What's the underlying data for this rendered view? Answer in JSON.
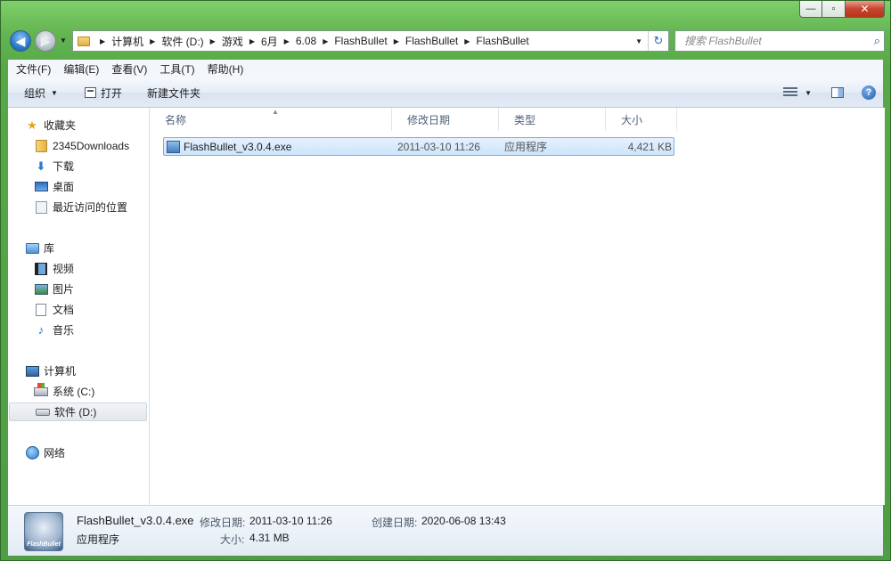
{
  "window": {
    "caption": {
      "minimize": "—",
      "maximize": "▫",
      "close": "✕"
    }
  },
  "nav": {
    "back": "◀",
    "forward": "▶",
    "drop": "▼"
  },
  "address": {
    "crumbs": [
      "计算机",
      "软件 (D:)",
      "游戏",
      "6月",
      "6.08",
      "FlashBullet",
      "FlashBullet",
      "FlashBullet"
    ],
    "refresh": "↻"
  },
  "search": {
    "placeholder": "搜索 FlashBullet"
  },
  "menu": [
    "文件(F)",
    "编辑(E)",
    "查看(V)",
    "工具(T)",
    "帮助(H)"
  ],
  "toolbar": {
    "organize": "组织",
    "open": "打开",
    "new_folder": "新建文件夹",
    "help": "?"
  },
  "sidebar": {
    "favorites": {
      "label": "收藏夹",
      "items": [
        "2345Downloads",
        "下载",
        "桌面",
        "最近访问的位置"
      ]
    },
    "libraries": {
      "label": "库",
      "items": [
        "视频",
        "图片",
        "文档",
        "音乐"
      ]
    },
    "computer": {
      "label": "计算机",
      "items": [
        "系统 (C:)",
        "软件 (D:)"
      ]
    },
    "network": {
      "label": "网络"
    }
  },
  "columns": [
    "名称",
    "修改日期",
    "类型",
    "大小"
  ],
  "files": [
    {
      "name": "FlashBullet_v3.0.4.exe",
      "modified": "2011-03-10 11:26",
      "type": "应用程序",
      "size": "4,421 KB"
    }
  ],
  "details": {
    "thumb_text": "FlashBullet",
    "filename": "FlashBullet_v3.0.4.exe",
    "type": "应用程序",
    "modified_label": "修改日期:",
    "modified": "2011-03-10 11:26",
    "created_label": "创建日期:",
    "created": "2020-06-08 13:43",
    "size_label": "大小:",
    "size": "4.31 MB"
  }
}
